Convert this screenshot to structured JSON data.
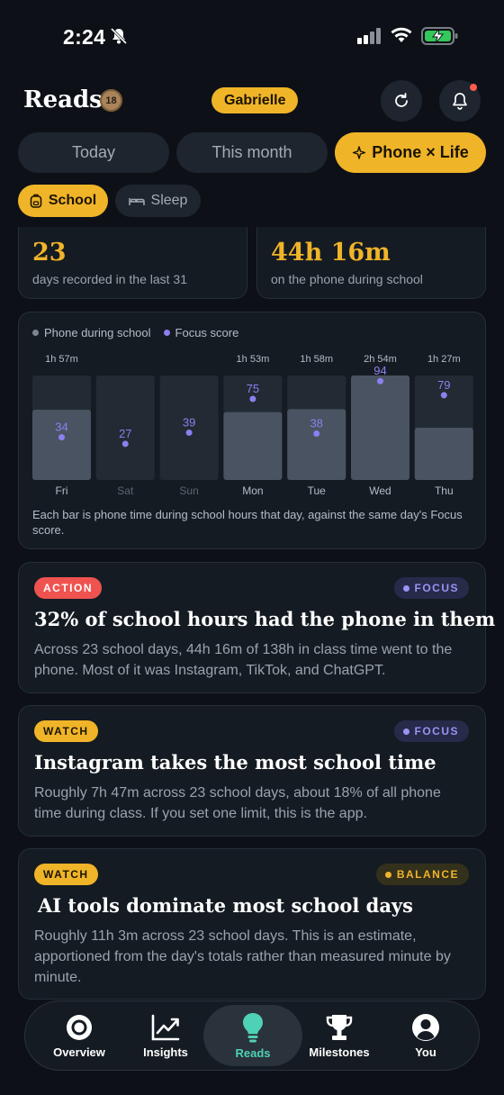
{
  "status": {
    "time": "2:24"
  },
  "header": {
    "title": "Reads",
    "badge_count": "18",
    "user_name": "Gabrielle"
  },
  "tabs": [
    {
      "label": "Today",
      "active": false
    },
    {
      "label": "This month",
      "active": false
    },
    {
      "label": "Phone × Life",
      "active": true
    }
  ],
  "sub_tabs": [
    {
      "label": "School",
      "active": true
    },
    {
      "label": "Sleep",
      "active": false
    }
  ],
  "stats": [
    {
      "value": "23",
      "label": "days recorded in the last 31"
    },
    {
      "value": "44h 16m",
      "label": "on the phone during school"
    }
  ],
  "chart": {
    "legend": {
      "phone": "Phone during school",
      "focus": "Focus score"
    },
    "caption": "Each bar is phone time during school hours that day, against the same day's Focus score."
  },
  "chart_data": {
    "type": "bar",
    "categories": [
      "Fri",
      "Sat",
      "Sun",
      "Mon",
      "Tue",
      "Wed",
      "Thu"
    ],
    "series": [
      {
        "name": "Phone during school",
        "values_minutes": [
          117,
          0,
          0,
          113,
          118,
          174,
          87
        ],
        "labels": [
          "1h 57m",
          "",
          "",
          "1h 53m",
          "1h 58m",
          "2h 54m",
          "1h 27m"
        ]
      },
      {
        "name": "Focus score",
        "values": [
          34,
          27,
          39,
          75,
          38,
          94,
          79
        ]
      }
    ],
    "school_days": [
      true,
      false,
      false,
      true,
      true,
      true,
      true
    ],
    "colors": {
      "bar": "#4a5361",
      "track": "#222a33",
      "focus": "#8b80ef"
    }
  },
  "insights": [
    {
      "tag": "ACTION",
      "tag_kind": "action",
      "category": "FOCUS",
      "category_kind": "focus",
      "title": "32% of school hours had the phone in them",
      "body": "Across 23 school days, 44h 16m of 138h in class time went to the phone. Most of it was Instagram, TikTok, and ChatGPT."
    },
    {
      "tag": "WATCH",
      "tag_kind": "watch",
      "category": "FOCUS",
      "category_kind": "focus",
      "title": "Instagram takes the most school time",
      "body": "Roughly 7h 47m across 23 school days, about 18% of all phone time during class. If you set one limit, this is the app."
    },
    {
      "tag": "WATCH",
      "tag_kind": "watch",
      "category": "BALANCE",
      "category_kind": "balance",
      "title": "AI tools dominate most school days",
      "body": "Roughly 11h 3m across 23 school days. This is an estimate, apportioned from the day's totals rather than measured minute by minute."
    }
  ],
  "nav": [
    {
      "label": "Overview",
      "icon": "target-icon"
    },
    {
      "label": "Insights",
      "icon": "trend-icon"
    },
    {
      "label": "Reads",
      "icon": "lightbulb-icon"
    },
    {
      "label": "Milestones",
      "icon": "trophy-icon"
    },
    {
      "label": "You",
      "icon": "user-icon"
    }
  ],
  "nav_active": "Reads",
  "colors": {
    "accent": "#f0b429",
    "background": "#0d1117",
    "card": "#151b22",
    "focus": "#8b80ef",
    "action": "#ef5350",
    "active_nav": "#4fd1b5"
  }
}
